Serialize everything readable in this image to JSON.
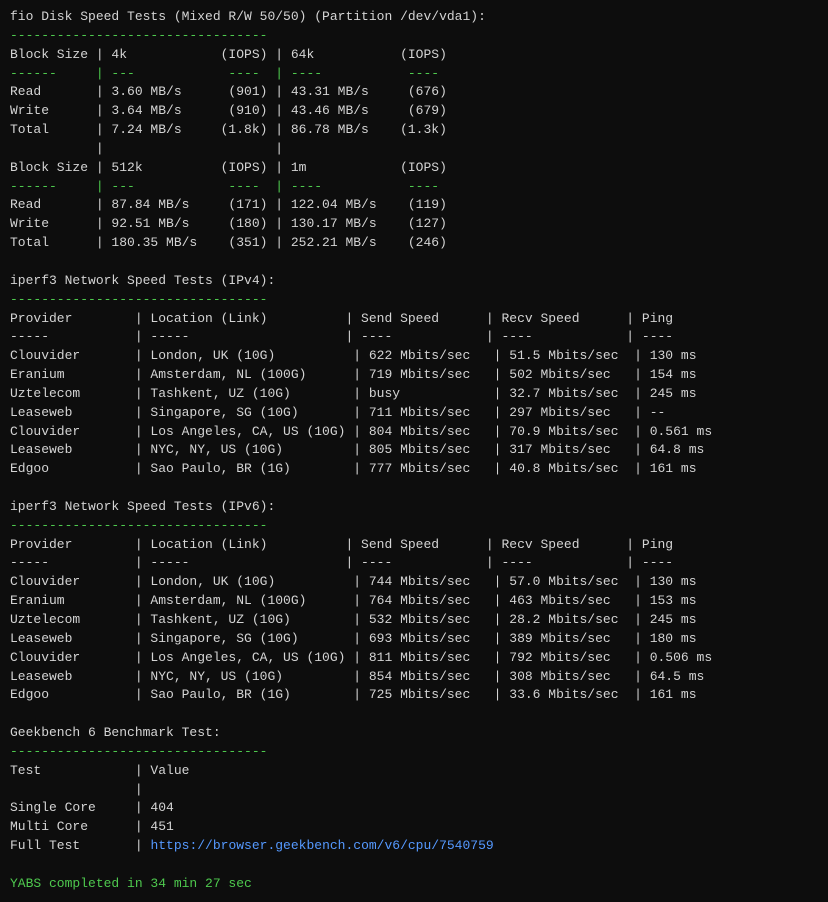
{
  "terminal": {
    "lines": [
      "fio Disk Speed Tests (Mixed R/W 50/50) (Partition /dev/vda1):",
      "---------------------------------",
      "Block Size | 4k            (IOPS) | 64k           (IOPS)",
      "------     | ---            ----  | ----           ----",
      "Read       | 3.60 MB/s      (901) | 43.31 MB/s     (676)",
      "Write      | 3.64 MB/s      (910) | 43.46 MB/s     (679)",
      "Total      | 7.24 MB/s     (1.8k) | 86.78 MB/s    (1.3k)",
      "           |                      |",
      "Block Size | 512k          (IOPS) | 1m            (IOPS)",
      "------     | ---            ----  | ----           ----",
      "Read       | 87.84 MB/s     (171) | 122.04 MB/s    (119)",
      "Write      | 92.51 MB/s     (180) | 130.17 MB/s    (127)",
      "Total      | 180.35 MB/s    (351) | 252.21 MB/s    (246)",
      "",
      "iperf3 Network Speed Tests (IPv4):",
      "---------------------------------",
      "Provider        | Location (Link)          | Send Speed      | Recv Speed      | Ping",
      "-----           | -----                    | ----            | ----            | ----",
      "Clouvider       | London, UK (10G)          | 622 Mbits/sec   | 51.5 Mbits/sec  | 130 ms",
      "Eranium         | Amsterdam, NL (100G)      | 719 Mbits/sec   | 502 Mbits/sec   | 154 ms",
      "Uztelecom       | Tashkent, UZ (10G)        | busy            | 32.7 Mbits/sec  | 245 ms",
      "Leaseweb        | Singapore, SG (10G)       | 711 Mbits/sec   | 297 Mbits/sec   | --",
      "Clouvider       | Los Angeles, CA, US (10G) | 804 Mbits/sec   | 70.9 Mbits/sec  | 0.561 ms",
      "Leaseweb        | NYC, NY, US (10G)         | 805 Mbits/sec   | 317 Mbits/sec   | 64.8 ms",
      "Edgoo           | Sao Paulo, BR (1G)        | 777 Mbits/sec   | 40.8 Mbits/sec  | 161 ms",
      "",
      "iperf3 Network Speed Tests (IPv6):",
      "---------------------------------",
      "Provider        | Location (Link)          | Send Speed      | Recv Speed      | Ping",
      "-----           | -----                    | ----            | ----            | ----",
      "Clouvider       | London, UK (10G)          | 744 Mbits/sec   | 57.0 Mbits/sec  | 130 ms",
      "Eranium         | Amsterdam, NL (100G)      | 764 Mbits/sec   | 463 Mbits/sec   | 153 ms",
      "Uztelecom       | Tashkent, UZ (10G)        | 532 Mbits/sec   | 28.2 Mbits/sec  | 245 ms",
      "Leaseweb        | Singapore, SG (10G)       | 693 Mbits/sec   | 389 Mbits/sec   | 180 ms",
      "Clouvider       | Los Angeles, CA, US (10G) | 811 Mbits/sec   | 792 Mbits/sec   | 0.506 ms",
      "Leaseweb        | NYC, NY, US (10G)         | 854 Mbits/sec   | 308 Mbits/sec   | 64.5 ms",
      "Edgoo           | Sao Paulo, BR (1G)        | 725 Mbits/sec   | 33.6 Mbits/sec  | 161 ms",
      "",
      "Geekbench 6 Benchmark Test:",
      "---------------------------------",
      "Test            | Value",
      "                |",
      "Single Core     | 404",
      "Multi Core      | 451",
      "Full Test       | https://browser.geekbench.com/v6/cpu/7540759",
      "",
      "YABS completed in 34 min 27 sec"
    ]
  }
}
